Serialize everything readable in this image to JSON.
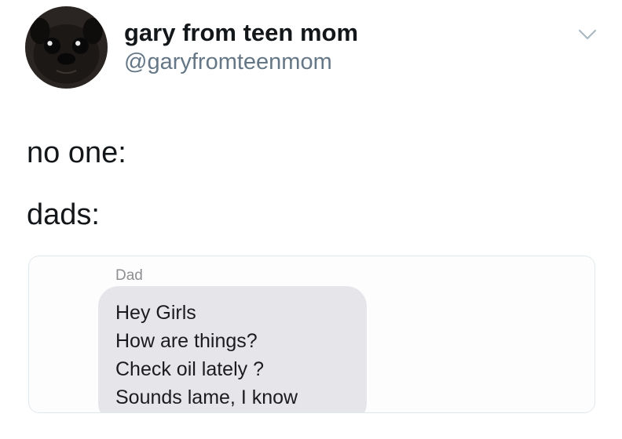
{
  "author": {
    "display_name": "gary from teen mom",
    "handle": "@garyfromteenmom",
    "avatar_icon": "pug-avatar-icon"
  },
  "menu_icon": "chevron-down-icon",
  "tweet": {
    "lines": [
      "no one:",
      "dads:"
    ]
  },
  "screenshot": {
    "sender": "Dad",
    "message_lines": [
      "Hey Girls",
      "How are things?",
      "Check oil lately ?",
      "Sounds lame, I know"
    ]
  },
  "colors": {
    "text_primary": "#14171a",
    "text_secondary": "#657786",
    "bubble_gray": "#e5e5ea",
    "card_border": "#e1e8ed"
  }
}
